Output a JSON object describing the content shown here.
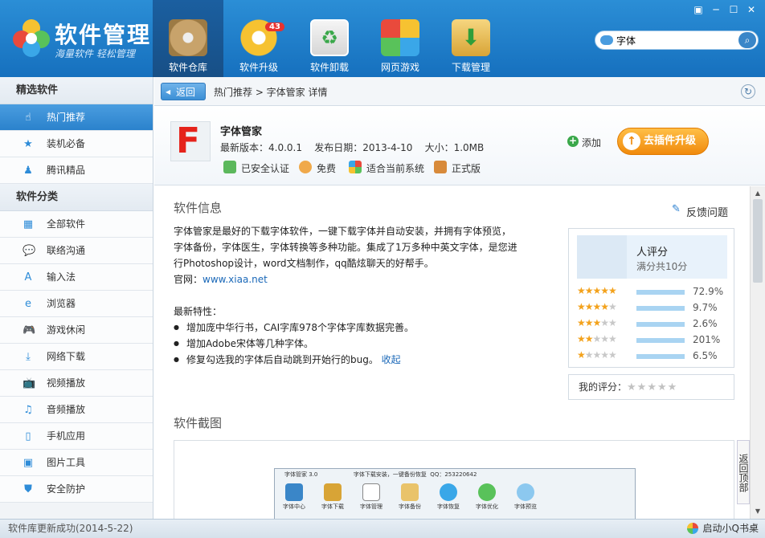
{
  "header": {
    "brand": "软件管理",
    "slogan": "海量软件 轻松管理",
    "nav": [
      {
        "label": "软件仓库",
        "icon": "disc-icon",
        "active": true
      },
      {
        "label": "软件升级",
        "icon": "upgrade-icon",
        "badge": "43"
      },
      {
        "label": "软件卸载",
        "icon": "recycle-bin-icon"
      },
      {
        "label": "网页游戏",
        "icon": "games-icon"
      },
      {
        "label": "下载管理",
        "icon": "download-box-icon"
      }
    ],
    "window_buttons": [
      "▣",
      "─",
      "☐",
      "✕"
    ],
    "search": {
      "value": "字体",
      "button": "⌕"
    }
  },
  "sidebar": {
    "section1": "精选软件",
    "featured": [
      {
        "label": "热门推荐",
        "icon": "hand-pointer-icon",
        "glyph": "☝"
      },
      {
        "label": "装机必备",
        "icon": "star-icon",
        "glyph": "★"
      },
      {
        "label": "腾讯精品",
        "icon": "qq-penguin-icon",
        "glyph": "♟"
      }
    ],
    "section2": "软件分类",
    "categories": [
      {
        "label": "全部软件",
        "icon": "grid-icon",
        "glyph": "▦"
      },
      {
        "label": "联络沟通",
        "icon": "chat-bubble-icon",
        "glyph": "💬"
      },
      {
        "label": "输入法",
        "icon": "keyboard-a-icon",
        "glyph": "A"
      },
      {
        "label": "浏览器",
        "icon": "ie-browser-icon",
        "glyph": "e"
      },
      {
        "label": "游戏休闲",
        "icon": "gamepad-icon",
        "glyph": "🎮"
      },
      {
        "label": "网络下载",
        "icon": "download-icon",
        "glyph": "⤓"
      },
      {
        "label": "视频播放",
        "icon": "tv-icon",
        "glyph": "📺"
      },
      {
        "label": "音频播放",
        "icon": "music-note-icon",
        "glyph": "♫"
      },
      {
        "label": "手机应用",
        "icon": "phone-icon",
        "glyph": "▯"
      },
      {
        "label": "图片工具",
        "icon": "picture-icon",
        "glyph": "▣"
      },
      {
        "label": "安全防护",
        "icon": "shield-icon",
        "glyph": "⛊"
      }
    ]
  },
  "crumbbar": {
    "back": "返回",
    "crumb": "热门推荐 > 字体管家 详情",
    "refresh": "↻"
  },
  "app": {
    "icon_letter": "F",
    "name": "字体管家",
    "meta": "最新版本：4.0.0.1    发布日期：2013-4-10    大小：1.0MB",
    "tags": [
      "已安全认证",
      "免费",
      "适合当前系统",
      "正式版"
    ],
    "add": "添加",
    "upgrade": "去插件升级"
  },
  "info": {
    "title": "软件信息",
    "desc_lines": [
      "字体管家是最好的下载字体软件，一键下载字体并自动安装，并拥有字体预览，",
      "字体备份，字体医生，字体转换等多种功能。集成了1万多种中英文字体，是您进",
      "行Photoshop设计，word文档制作，qq酷炫聊天的好帮手。"
    ],
    "site_label": "官网：",
    "site": "www.xiaa.net",
    "features_title": "最新特性：",
    "features": [
      "增加庞中华行书，CAI字库978个字体字库数据完善。",
      "增加Adobe宋体等几种字体。",
      "修复勾选我的字体后自动跳到开始行的bug。"
    ],
    "collapse": "收起",
    "feedback": "反馈问题"
  },
  "rating": {
    "people": "人评分",
    "full": "满分共10分",
    "rows": [
      {
        "stars": 5,
        "pct": "72.9%"
      },
      {
        "stars": 4,
        "pct": "9.7%"
      },
      {
        "stars": 3,
        "pct": "2.6%"
      },
      {
        "stars": 2,
        "pct": "201%"
      },
      {
        "stars": 1,
        "pct": "6.5%"
      }
    ],
    "my_label": "我的评分：",
    "my_stars": "★★★★★"
  },
  "screenshots": {
    "title": "软件截图",
    "mini_title": "字体管家 3.0                    字体下载安装，一键备份恢复  QQ：253220642",
    "mini_items": [
      "字体中心",
      "字体下载",
      "字体管理",
      "字体备份",
      "字体恢复",
      "字体优化",
      "字体预览"
    ]
  },
  "backtop": "返回顶部",
  "status": {
    "left": "软件库更新成功(2014-5-22)",
    "right": "启动小Q书桌"
  }
}
